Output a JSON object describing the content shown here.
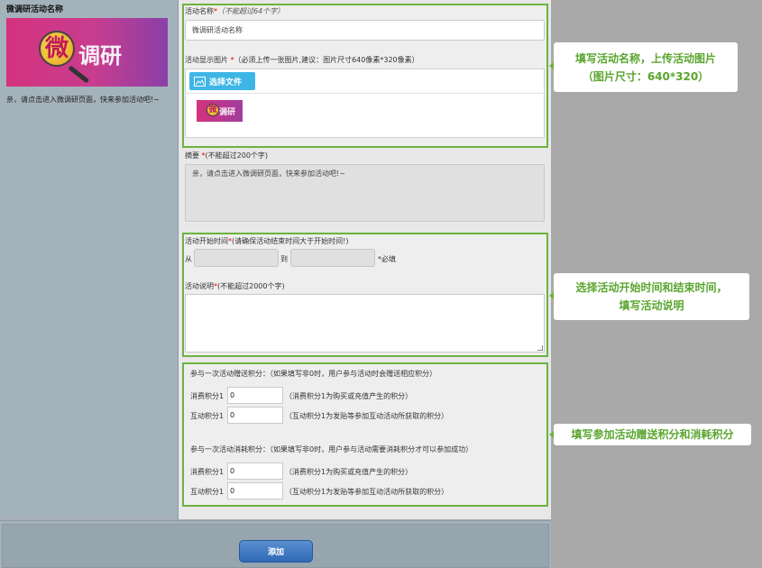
{
  "preview": {
    "title": "微调研活动名称",
    "logo_char": "微",
    "logo_text": "调研",
    "summary": "亲，请点击进入微调研页面，快来参加活动吧!~"
  },
  "section1": {
    "name_label": "活动名称",
    "name_required": "*",
    "name_hint": "（不能超过64个字）",
    "name_value": "微调研活动名称",
    "image_label": "活动显示图片",
    "image_required": "*",
    "image_hint": "（必须上传一张图片,建议：图片尺寸640像素*320像素）",
    "file_button": "选择文件"
  },
  "summary_field": {
    "label": "摘要",
    "required": "*",
    "hint": "(不能超过200个字)",
    "value": "亲，请点击进入微调研页面，快来参加活动吧!~"
  },
  "section2": {
    "time_label": "活动开始时间",
    "time_required": "*",
    "time_hint": "(请确保活动结束时间大于开始时间!)",
    "from_label": "从",
    "to_label": "到",
    "required_note": "*必填",
    "desc_label": "活动说明",
    "desc_required": "*",
    "desc_hint": "(不能超过2000个字)",
    "desc_value": ""
  },
  "section3": {
    "reward_title": "参与一次活动赠送积分：（如果填写非0时，用户参与活动时会赠送相应积分）",
    "consume_title": "参与一次活动消耗积分：（如果填写非0时，用户参与活动需要消耗积分才可以参加成功）",
    "rows": [
      {
        "label": "消费积分1",
        "value": "0",
        "note": "（消费积分1为购买或充值产生的积分）"
      },
      {
        "label": "互动积分1",
        "value": "0",
        "note": "（互动积分1为发贴等参加互动活动所获取的积分）"
      },
      {
        "label": "消费积分1",
        "value": "0",
        "note": "（消费积分1为购买或充值产生的积分）"
      },
      {
        "label": "互动积分1",
        "value": "0",
        "note": "（互动积分1为发贴等参加互动活动所获取的积分）"
      }
    ]
  },
  "add_button": "添加",
  "callouts": {
    "c1_line1": "填写活动名称，上传活动图片",
    "c1_line2": "（图片尺寸：640*320）",
    "c2_line1": "选择活动开始时间和结束时间，",
    "c2_line2": "填写活动说明",
    "c3_line1": "填写参加活动赠送积分和消耗积分"
  },
  "colors": {
    "accent_green": "#6cb33f",
    "callout_text": "#5aa52f",
    "button_blue": "#2f69b5",
    "file_button": "#3fb5e6",
    "required_red": "#ee0000"
  }
}
